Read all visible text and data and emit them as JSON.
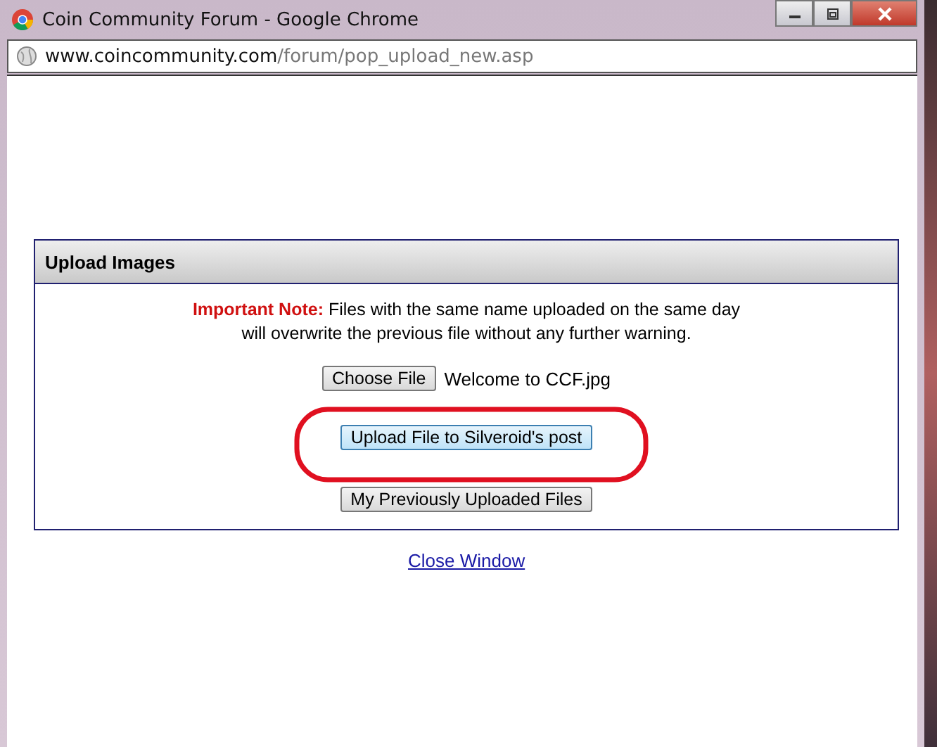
{
  "window": {
    "title": "Coin Community Forum - Google Chrome"
  },
  "address": {
    "host": "www.coincommunity.com",
    "path": "/forum/pop_upload_new.asp"
  },
  "panel": {
    "title": "Upload Images",
    "note_label": "Important Note:",
    "note_text": "Files with the same name uploaded on the same day will overwrite the previous file without any further warning.",
    "file_button": "Choose File",
    "file_name": "Welcome to CCF.jpg",
    "upload_button": {
      "label": "Upload File to Silveroid's post",
      "focused": true
    },
    "previous_button": "My Previously Uploaded Files"
  },
  "close_link": "Close Window"
}
